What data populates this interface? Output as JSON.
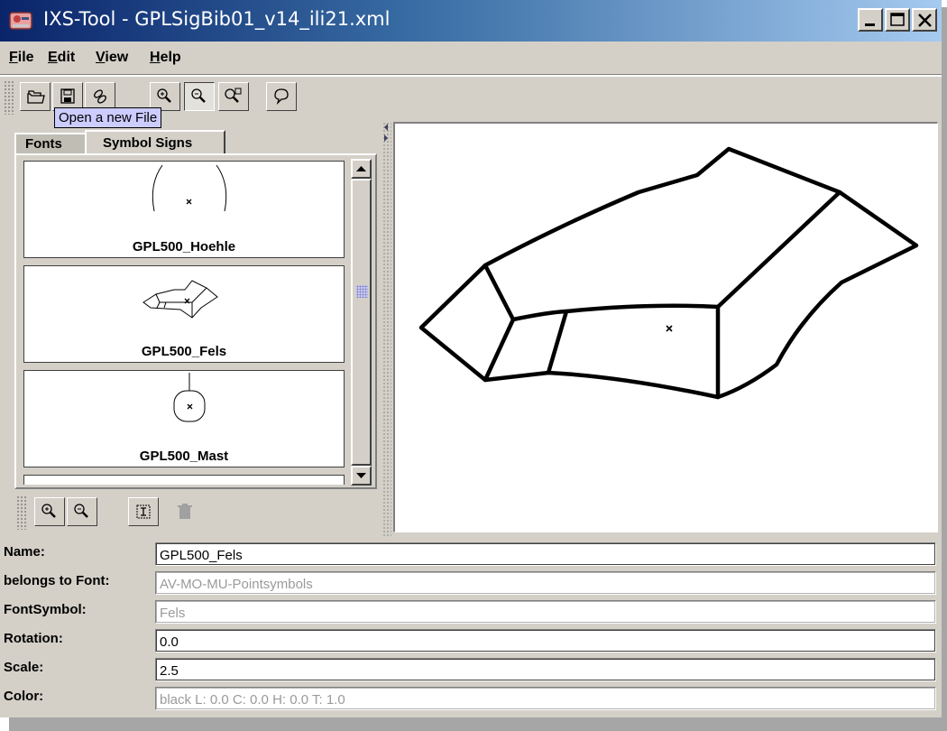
{
  "window": {
    "title": "IXS-Tool  -  GPLSigBib01_v14_ili21.xml",
    "controls": [
      "minimize-icon",
      "maximize-icon",
      "close-icon"
    ]
  },
  "menu": {
    "file": "File",
    "edit": "Edit",
    "view": "View",
    "help": "Help"
  },
  "toolbar": {
    "buttons": [
      "open-icon",
      "save-icon",
      "link-icon",
      "zoom-in-icon",
      "zoom-out-icon",
      "zoom-reset-icon",
      "comment-icon"
    ],
    "tooltip": "Open a new File"
  },
  "tabs": {
    "fonts": "Fonts",
    "symbol_signs": "Symbol Signs"
  },
  "symbols": [
    {
      "name": "GPL500_Hoehle"
    },
    {
      "name": "GPL500_Fels"
    },
    {
      "name": "GPL500_Mast"
    }
  ],
  "bottom_tools": [
    "zoom-in-icon",
    "zoom-out-icon",
    "properties-icon",
    "delete-icon"
  ],
  "properties": {
    "name_label": "Name:",
    "name_value": "GPL500_Fels",
    "font_label": "belongs to Font:",
    "font_value": "AV-MO-MU-Pointsymbols",
    "fontsymbol_label": "FontSymbol:",
    "fontsymbol_value": "Fels",
    "rotation_label": "Rotation:",
    "rotation_value": "0.0",
    "scale_label": "Scale:",
    "scale_value": "2.5",
    "color_label": "Color:",
    "color_value": "black  L: 0.0  C: 0.0  H: 0.0  T: 1.0"
  },
  "colors": {
    "titlebar_start": "#0a246a",
    "titlebar_end": "#a6caf0",
    "tooltip_bg": "#ccccff",
    "panel_bg": "#d4d0c8"
  }
}
